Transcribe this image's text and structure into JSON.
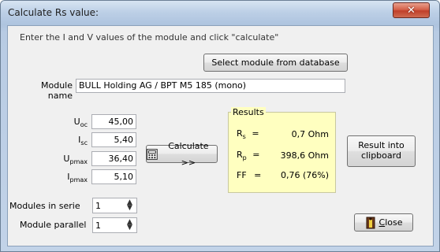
{
  "window": {
    "title": "Calculate Rs value:",
    "close_glyph": "✕"
  },
  "instruction": "Enter the I and V values of the module and click \"calculate\"",
  "select_db_label": "Select module from database",
  "module_name": {
    "label_line1": "Module",
    "label_line2": "name",
    "value": "BULL Holding AG / BPT M5 185 (mono)"
  },
  "inputs": [
    {
      "base": "U",
      "sub": "oc",
      "value": "45,00"
    },
    {
      "base": "I",
      "sub": "sc",
      "value": "5,40"
    },
    {
      "base": "U",
      "sub": "pmax",
      "value": "36,40"
    },
    {
      "base": "I",
      "sub": "pmax",
      "value": "5,10"
    }
  ],
  "calculate_label": "Calculate >>",
  "calculate_icon": "calculator-icon",
  "modules_serie": {
    "label": "Modules in serie",
    "value": "1"
  },
  "module_parallel": {
    "label": "Module parallel",
    "value": "1"
  },
  "results": {
    "legend": "Results",
    "rows": [
      {
        "base": "R",
        "sub": "s",
        "eq": "=",
        "value": "0,7 Ohm"
      },
      {
        "base": "R",
        "sub": "p",
        "eq": "=",
        "value": "398,6 Ohm"
      },
      {
        "base": "FF",
        "sub": "",
        "eq": "=",
        "value": "0,76 (76%)"
      }
    ]
  },
  "clipboard_label_line1": "Result into",
  "clipboard_label_line2": "clipboard",
  "close_button": {
    "label_first": "C",
    "label_rest": "lose",
    "icon": "door-exit-icon"
  },
  "colors": {
    "results_bg": "#ffffc0",
    "title_close_red": "#c0402a"
  }
}
